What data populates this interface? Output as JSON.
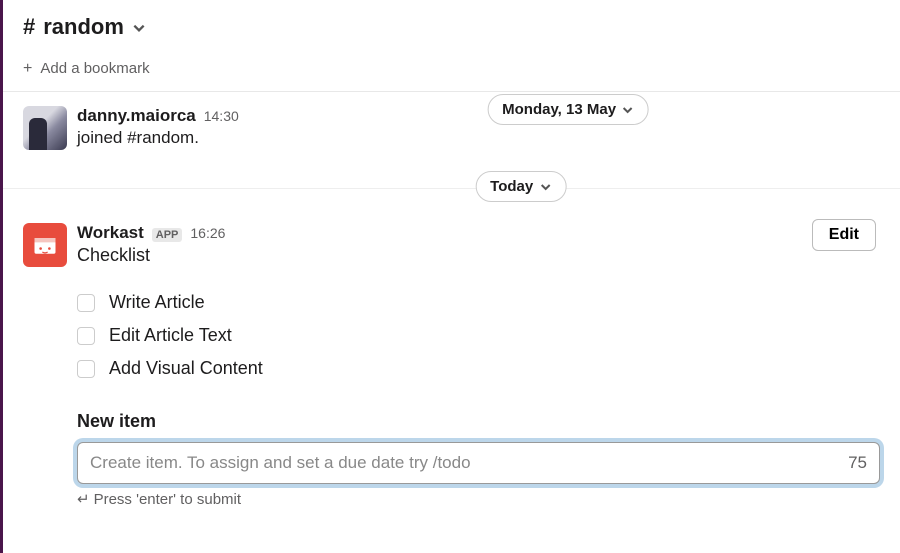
{
  "header": {
    "hash": "#",
    "channel": "random"
  },
  "bookmark": {
    "plus": "+",
    "label": "Add a bookmark"
  },
  "msg1": {
    "sender": "danny.maiorca",
    "time": "14:30",
    "text": "joined #random.",
    "date_pill": "Monday, 13 May"
  },
  "today_pill": "Today",
  "msg2": {
    "sender": "Workast",
    "app": "APP",
    "time": "16:26",
    "title": "Checklist",
    "edit": "Edit",
    "items": [
      "Write Article",
      "Edit Article Text",
      "Add Visual Content"
    ],
    "new_item_label": "New item",
    "placeholder": "Create item. To assign and set a due date try /todo",
    "char_count": "75",
    "hint": "Press 'enter' to submit",
    "return_glyph": "↵"
  }
}
